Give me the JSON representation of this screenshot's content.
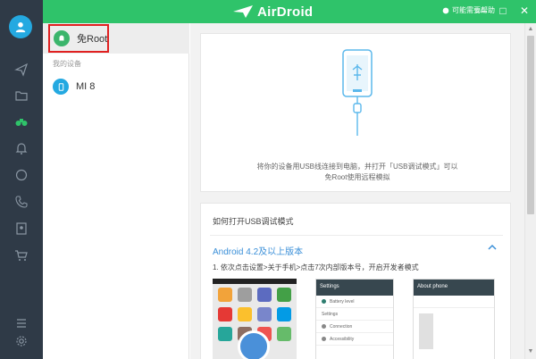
{
  "app": {
    "brand": "AirDroid"
  },
  "topbar": {
    "help_text": "可能需要帮助",
    "minimize": "—",
    "maximize": "□",
    "close": "✕"
  },
  "list": {
    "root_item": "免Root",
    "group_label": "我的设备",
    "device_name": "MI 8"
  },
  "usb_card": {
    "line1": "将你的设备用USB线连接到电脑，并打开「USB调试模式」可以",
    "line2": "免Root使用远程模拟"
  },
  "guide": {
    "title": "如何打开USB调试模式",
    "android_section": "Android 4.2及以上版本",
    "step1": "1. 依次点击设置>关于手机>点击7次内部版本号，开启开发者模式",
    "shot2_header": "Settings",
    "shot2_rows": [
      "Battery level",
      "Settings",
      "Connection",
      "Accessibility"
    ],
    "shot3_header": "About phone"
  },
  "colors": {
    "nav_bg": "#2f3a47",
    "topbar": "#2fc36a",
    "accent_blue": "#24a9e1",
    "link_blue": "#3a8fd8",
    "highlight_red": "#e02020",
    "green_root": "#3bb56b"
  }
}
